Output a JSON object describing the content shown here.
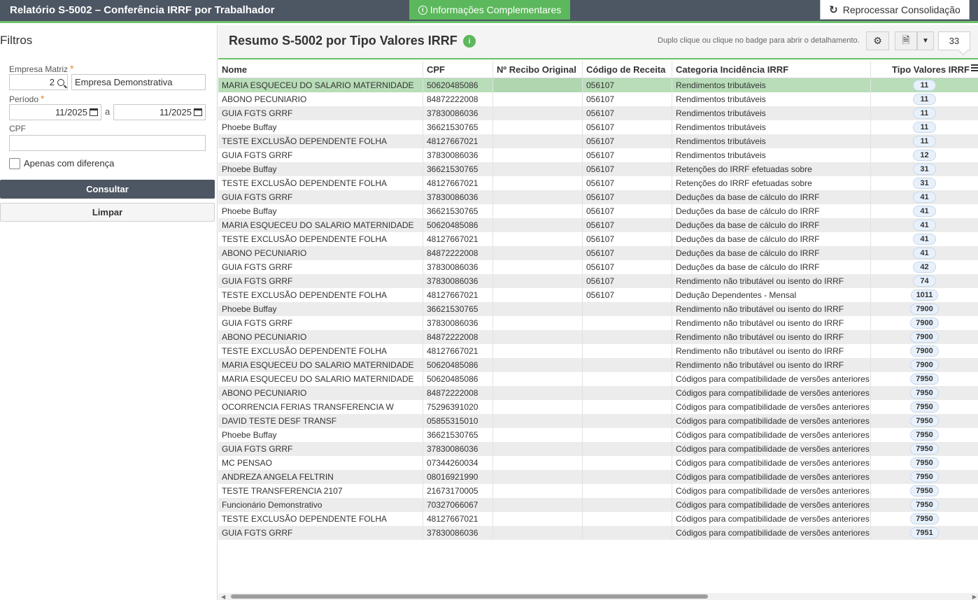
{
  "header": {
    "title": "Relatório S-5002 – Conferência IRRF por Trabalhador",
    "info_button": "Informações Complementares",
    "reprocess_button": "Reprocessar Consolidação"
  },
  "filters": {
    "title": "Filtros",
    "empresa_label": "Empresa Matriz",
    "empresa_code": "2",
    "empresa_name": "Empresa Demonstrativa",
    "periodo_label": "Período",
    "periodo_from": "11/2025",
    "periodo_sep": "a",
    "periodo_to": "11/2025",
    "cpf_label": "CPF",
    "cpf_value": "",
    "only_diff_label": "Apenas com diferença",
    "required_mark": "*",
    "consult_button": "Consultar",
    "clear_button": "Limpar"
  },
  "panel": {
    "title": "Resumo S-5002 por Tipo Valores IRRF",
    "info_badge": "i",
    "hint": "Duplo clique ou clique no badge para abrir o detalhamento.",
    "record_count": "33"
  },
  "table": {
    "columns": [
      "Nome",
      "CPF",
      "Nº Recibo Original",
      "Código de Receita",
      "Categoria Incidência IRRF",
      "Tipo Valores IRRF"
    ],
    "rows": [
      [
        "MARIA ESQUECEU DO SALARIO MATERNIDADE",
        "50620485086",
        "",
        "056107",
        "Rendimentos tributáveis",
        "11"
      ],
      [
        "ABONO PECUNIARIO",
        "84872222008",
        "",
        "056107",
        "Rendimentos tributáveis",
        "11"
      ],
      [
        "GUIA FGTS GRRF",
        "37830086036",
        "",
        "056107",
        "Rendimentos tributáveis",
        "11"
      ],
      [
        "Phoebe Buffay",
        "36621530765",
        "",
        "056107",
        "Rendimentos tributáveis",
        "11"
      ],
      [
        "TESTE EXCLUSÃO DEPENDENTE FOLHA",
        "48127667021",
        "",
        "056107",
        "Rendimentos tributáveis",
        "11"
      ],
      [
        "GUIA FGTS GRRF",
        "37830086036",
        "",
        "056107",
        "Rendimentos tributáveis",
        "12"
      ],
      [
        "Phoebe Buffay",
        "36621530765",
        "",
        "056107",
        "Retenções do IRRF efetuadas sobre",
        "31"
      ],
      [
        "TESTE EXCLUSÃO DEPENDENTE FOLHA",
        "48127667021",
        "",
        "056107",
        "Retenções do IRRF efetuadas sobre",
        "31"
      ],
      [
        "GUIA FGTS GRRF",
        "37830086036",
        "",
        "056107",
        "Deduções da base de cálculo do IRRF",
        "41"
      ],
      [
        "Phoebe Buffay",
        "36621530765",
        "",
        "056107",
        "Deduções da base de cálculo do IRRF",
        "41"
      ],
      [
        "MARIA ESQUECEU DO SALARIO MATERNIDADE",
        "50620485086",
        "",
        "056107",
        "Deduções da base de cálculo do IRRF",
        "41"
      ],
      [
        "TESTE EXCLUSÃO DEPENDENTE FOLHA",
        "48127667021",
        "",
        "056107",
        "Deduções da base de cálculo do IRRF",
        "41"
      ],
      [
        "ABONO PECUNIARIO",
        "84872222008",
        "",
        "056107",
        "Deduções da base de cálculo do IRRF",
        "41"
      ],
      [
        "GUIA FGTS GRRF",
        "37830086036",
        "",
        "056107",
        "Deduções da base de cálculo do IRRF",
        "42"
      ],
      [
        "GUIA FGTS GRRF",
        "37830086036",
        "",
        "056107",
        "Rendimento não tributável ou isento do IRRF",
        "74"
      ],
      [
        "TESTE EXCLUSÃO DEPENDENTE FOLHA",
        "48127667021",
        "",
        "056107",
        "Dedução Dependentes - Mensal",
        "1011"
      ],
      [
        "Phoebe Buffay",
        "36621530765",
        "",
        "",
        "Rendimento não tributável ou isento do IRRF",
        "7900"
      ],
      [
        "GUIA FGTS GRRF",
        "37830086036",
        "",
        "",
        "Rendimento não tributável ou isento do IRRF",
        "7900"
      ],
      [
        "ABONO PECUNIARIO",
        "84872222008",
        "",
        "",
        "Rendimento não tributável ou isento do IRRF",
        "7900"
      ],
      [
        "TESTE EXCLUSÃO DEPENDENTE FOLHA",
        "48127667021",
        "",
        "",
        "Rendimento não tributável ou isento do IRRF",
        "7900"
      ],
      [
        "MARIA ESQUECEU DO SALARIO MATERNIDADE",
        "50620485086",
        "",
        "",
        "Rendimento não tributável ou isento do IRRF",
        "7900"
      ],
      [
        "MARIA ESQUECEU DO SALARIO MATERNIDADE",
        "50620485086",
        "",
        "",
        "Códigos para compatibilidade de versões anteriores",
        "7950"
      ],
      [
        "ABONO PECUNIARIO",
        "84872222008",
        "",
        "",
        "Códigos para compatibilidade de versões anteriores",
        "7950"
      ],
      [
        "OCORRENCIA FERIAS TRANSFERENCIA W",
        "75296391020",
        "",
        "",
        "Códigos para compatibilidade de versões anteriores",
        "7950"
      ],
      [
        "DAVID TESTE DESF TRANSF",
        "05855315010",
        "",
        "",
        "Códigos para compatibilidade de versões anteriores",
        "7950"
      ],
      [
        "Phoebe Buffay",
        "36621530765",
        "",
        "",
        "Códigos para compatibilidade de versões anteriores",
        "7950"
      ],
      [
        "GUIA FGTS GRRF",
        "37830086036",
        "",
        "",
        "Códigos para compatibilidade de versões anteriores",
        "7950"
      ],
      [
        "MC PENSAO",
        "07344260034",
        "",
        "",
        "Códigos para compatibilidade de versões anteriores",
        "7950"
      ],
      [
        "ANDREZA ANGELA FELTRIN",
        "08016921990",
        "",
        "",
        "Códigos para compatibilidade de versões anteriores",
        "7950"
      ],
      [
        "TESTE TRANSFERENCIA 2107",
        "21673170005",
        "",
        "",
        "Códigos para compatibilidade de versões anteriores",
        "7950"
      ],
      [
        "Funcionário Demonstrativo",
        "70327066067",
        "",
        "",
        "Códigos para compatibilidade de versões anteriores",
        "7950"
      ],
      [
        "TESTE EXCLUSÃO DEPENDENTE FOLHA",
        "48127667021",
        "",
        "",
        "Códigos para compatibilidade de versões anteriores",
        "7950"
      ],
      [
        "GUIA FGTS GRRF",
        "37830086036",
        "",
        "",
        "Códigos para compatibilidade de versões anteriores",
        "7951"
      ]
    ],
    "selected_row": 0
  },
  "icons": {
    "info": "info-circle-icon",
    "reprocess": "refresh-icon",
    "search": "search-icon",
    "calendar": "calendar-icon",
    "settings": "gear-icon",
    "export": "export-file-icon",
    "dropdown": "chevron-down-icon",
    "columns_menu": "hamburger-menu-icon"
  },
  "colors": {
    "header_bg": "#4d5663",
    "accent_green": "#5cb85c",
    "selected_row": "#b8ddb8"
  }
}
